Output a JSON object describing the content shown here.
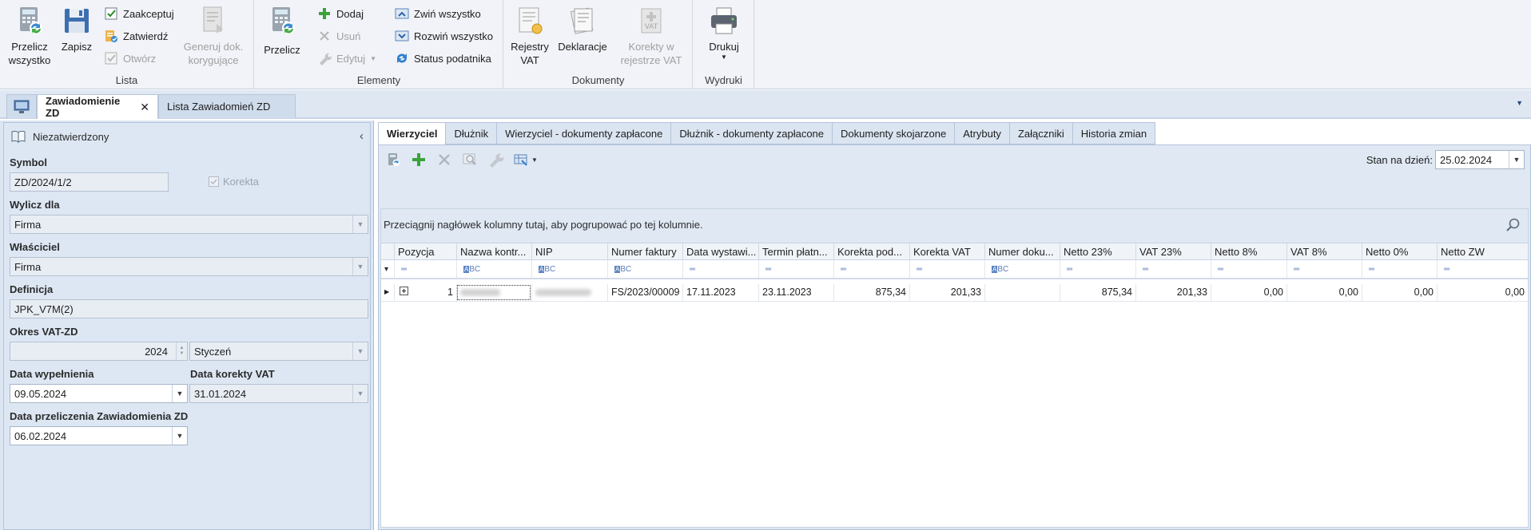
{
  "ribbon": {
    "groups": {
      "lista": {
        "label": "Lista",
        "przelicz": "Przelicz wszystko",
        "zapisz": "Zapisz",
        "zaakceptuj": "Zaakceptuj",
        "zatwierdz": "Zatwierdź",
        "otworz": "Otwórz",
        "generuj": "Generuj dok. korygujące"
      },
      "elementy": {
        "label": "Elementy",
        "przelicz": "Przelicz",
        "dodaj": "Dodaj",
        "usun": "Usuń",
        "edytuj": "Edytuj",
        "zwin": "Zwiń wszystko",
        "rozwin": "Rozwiń wszystko",
        "status": "Status podatnika"
      },
      "dokumenty": {
        "label": "Dokumenty",
        "rejestry": "Rejestry VAT",
        "deklaracje": "Deklaracje",
        "korekty": "Korekty w rejestrze VAT"
      },
      "wydruki": {
        "label": "Wydruki",
        "drukuj": "Drukuj"
      }
    }
  },
  "doc_tabs": {
    "active": "Zawiadomienie ZD",
    "other": "Lista Zawiadomień ZD"
  },
  "form": {
    "status": "Niezatwierdzony",
    "symbol_label": "Symbol",
    "symbol_value": "ZD/2024/1/2",
    "korekta_label": "Korekta",
    "wylicz_label": "Wylicz dla",
    "wylicz_value": "Firma",
    "wlasciciel_label": "Właściciel",
    "wlasciciel_value": "Firma",
    "definicja_label": "Definicja",
    "definicja_value": "JPK_V7M(2)",
    "okres_label": "Okres VAT-ZD",
    "okres_year": "2024",
    "okres_month": "Styczeń",
    "data_wyp_label": "Data wypełnienia",
    "data_wyp_value": "09.05.2024",
    "data_kor_label": "Data korekty VAT",
    "data_kor_value": "31.01.2024",
    "data_przel_label": "Data przeliczenia Zawiadomienia ZD",
    "data_przel_value": "06.02.2024"
  },
  "panel_tabs": [
    "Wierzyciel",
    "Dłużnik",
    "Wierzyciel - dokumenty zapłacone",
    "Dłużnik - dokumenty zapłacone",
    "Dokumenty skojarzone",
    "Atrybuty",
    "Załączniki",
    "Historia zmian"
  ],
  "stan_label": "Stan na dzień:",
  "stan_value": "25.02.2024",
  "group_hint": "Przeciągnij nagłówek kolumny tutaj, aby pogrupować po tej kolumnie.",
  "columns": [
    "Pozycja",
    "Nazwa kontr...",
    "NIP",
    "Numer faktury",
    "Data wystawi...",
    "Termin płatn...",
    "Korekta pod...",
    "Korekta VAT",
    "Numer doku...",
    "Netto 23%",
    "VAT 23%",
    "Netto 8%",
    "VAT 8%",
    "Netto 0%",
    "Netto ZW"
  ],
  "rows": [
    [
      "1",
      "",
      "",
      "FS/2023/00009",
      "17.11.2023",
      "23.11.2023",
      "875,34",
      "201,33",
      "",
      "875,34",
      "201,33",
      "0,00",
      "0,00",
      "0,00",
      "0,00"
    ]
  ]
}
